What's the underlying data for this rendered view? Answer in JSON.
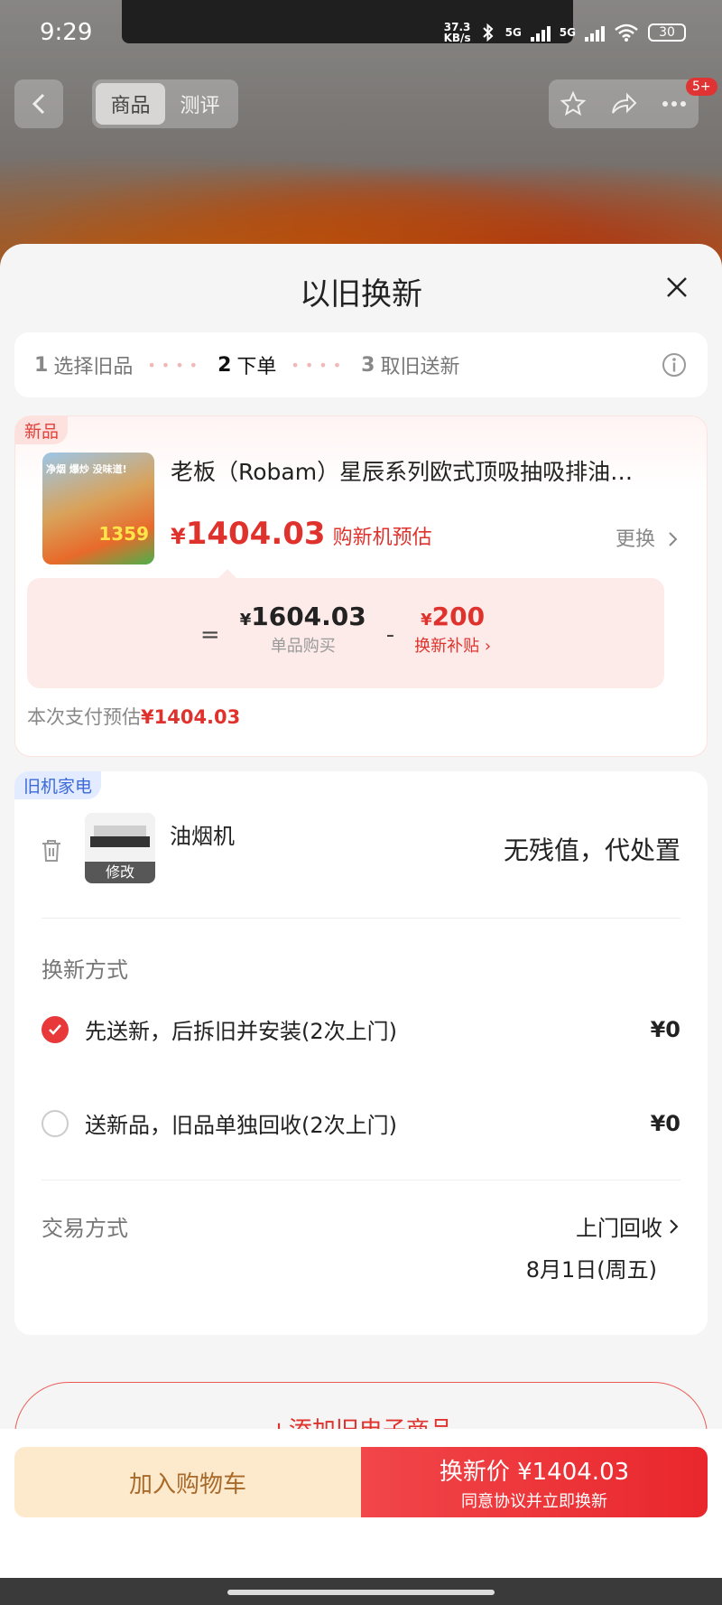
{
  "status_bar": {
    "time": "9:29",
    "net_speed_value": "37.3",
    "net_speed_unit": "KB/s",
    "network_1": "5G",
    "network_2": "5G",
    "battery": "30"
  },
  "nav": {
    "tabs": [
      "商品",
      "测评"
    ],
    "active_tab": "商品",
    "badge": "5+"
  },
  "sheet": {
    "title": "以旧换新",
    "steps": [
      {
        "num": "1",
        "label": "选择旧品"
      },
      {
        "num": "2",
        "label": "下单"
      },
      {
        "num": "3",
        "label": "取旧送新"
      }
    ],
    "current_step": 2
  },
  "new_product": {
    "tag": "新品",
    "name": "老板（Robam）星辰系列欧式顶吸抽吸排油…",
    "price_symbol": "¥",
    "price": "1404.03",
    "price_note": "购新机预估",
    "change_label": "更换",
    "img_text_top": "净烟 爆炒 没味道!",
    "img_text_price": "1359",
    "calc": {
      "equals": "=",
      "unit_price": "1604.03",
      "unit_price_label": "单品购买",
      "minus": "-",
      "subsidy": "200",
      "subsidy_label": "换新补贴",
      "currency": "¥"
    },
    "pay_estimate_label": "本次支付预估",
    "pay_estimate_value": "¥1404.03"
  },
  "old_appliance": {
    "tag": "旧机家电",
    "name": "油烟机",
    "edit_label": "修改",
    "value_text": "无残值，代处置",
    "method_label": "换新方式",
    "options": [
      {
        "label": "先送新，后拆旧并安装(2次上门)",
        "price": "¥0",
        "selected": true
      },
      {
        "label": "送新品，旧品单独回收(2次上门)",
        "price": "¥0",
        "selected": false
      }
    ],
    "trade_label": "交易方式",
    "trade_method": "上门回收",
    "trade_date": "8月1日(周五)"
  },
  "add_old_label": "+添加旧电子商品",
  "bottom": {
    "cart_label": "加入购物车",
    "trade_main": "换新价 ¥1404.03",
    "trade_sub": "同意协议并立即换新"
  }
}
